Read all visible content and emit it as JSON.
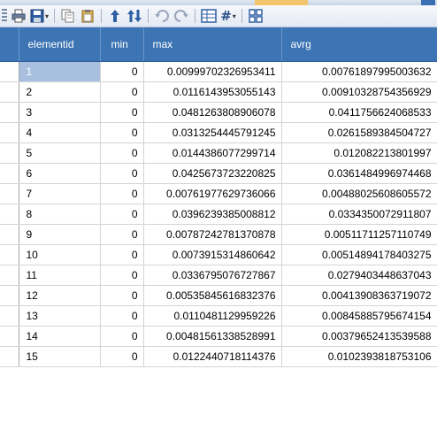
{
  "toolbar": {
    "icons": [
      "print-icon",
      "save-icon",
      "copy-icon",
      "paste-icon",
      "sort-ascending-icon",
      "sort-descending-icon",
      "undo-icon",
      "redo-icon",
      "grid-view-icon",
      "hash-icon",
      "layout-icon"
    ],
    "hash_label": "#"
  },
  "table": {
    "columns": [
      "elementid",
      "min",
      "max",
      "avrg"
    ],
    "rows": [
      {
        "elementid": "1",
        "min": "0",
        "max": "0.00999702326953411",
        "avrg": "0.00761897995003632"
      },
      {
        "elementid": "2",
        "min": "0",
        "max": "0.0116143953055143",
        "avrg": "0.00910328754356929"
      },
      {
        "elementid": "3",
        "min": "0",
        "max": "0.0481263808906078",
        "avrg": "0.0411756624068533"
      },
      {
        "elementid": "4",
        "min": "0",
        "max": "0.0313254445791245",
        "avrg": "0.0261589384504727"
      },
      {
        "elementid": "5",
        "min": "0",
        "max": "0.0144386077299714",
        "avrg": "0.012082213801997"
      },
      {
        "elementid": "6",
        "min": "0",
        "max": "0.0425673723220825",
        "avrg": "0.0361484996974468"
      },
      {
        "elementid": "7",
        "min": "0",
        "max": "0.00761977629736066",
        "avrg": "0.00488025608605572"
      },
      {
        "elementid": "8",
        "min": "0",
        "max": "0.0396239385008812",
        "avrg": "0.0334350072911807"
      },
      {
        "elementid": "9",
        "min": "0",
        "max": "0.00787242781370878",
        "avrg": "0.00511711257110749"
      },
      {
        "elementid": "10",
        "min": "0",
        "max": "0.0073915314860642",
        "avrg": "0.00514894178403275"
      },
      {
        "elementid": "11",
        "min": "0",
        "max": "0.0336795076727867",
        "avrg": "0.0279403448637043"
      },
      {
        "elementid": "12",
        "min": "0",
        "max": "0.00535845616832376",
        "avrg": "0.00413908363719072"
      },
      {
        "elementid": "13",
        "min": "0",
        "max": "0.0110481129959226",
        "avrg": "0.00845885795674154"
      },
      {
        "elementid": "14",
        "min": "0",
        "max": "0.00481561338528991",
        "avrg": "0.00379652413539588"
      },
      {
        "elementid": "15",
        "min": "0",
        "max": "0.0122440718114376",
        "avrg": "0.0102393818753106"
      }
    ],
    "selected_row": 0
  },
  "colors": {
    "header_bg": "#3c74b4",
    "selected_cell_bg": "#a8bfe0",
    "grid_line": "#d4d4d4"
  }
}
